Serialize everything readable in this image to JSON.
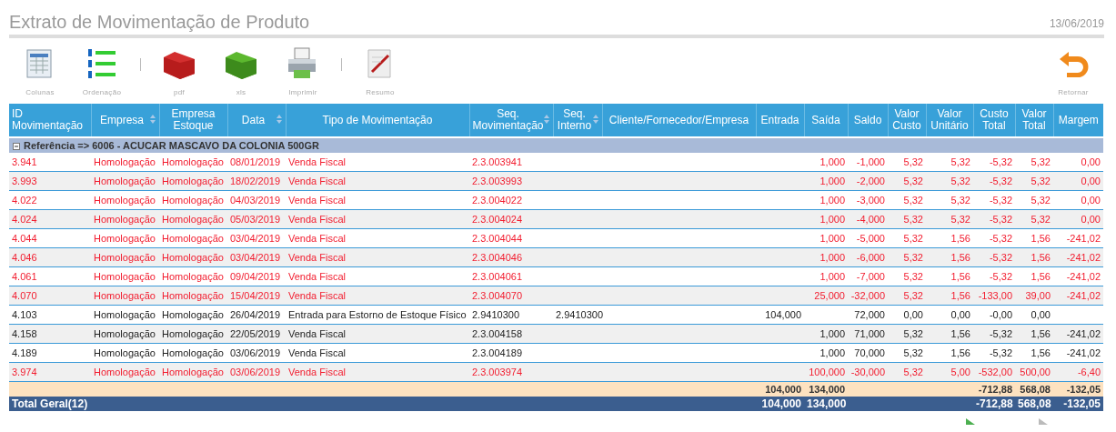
{
  "title": "Extrato de Movimentação de Produto",
  "date": "13/06/2019",
  "toolbar": [
    {
      "label": "Colunas",
      "kind": "columns"
    },
    {
      "label": "Ordenação",
      "kind": "order"
    },
    {
      "kind": "separator"
    },
    {
      "label": "pdf",
      "kind": "pdf"
    },
    {
      "label": "xls",
      "kind": "xls"
    },
    {
      "label": "Imprimir",
      "kind": "print"
    },
    {
      "kind": "separator"
    },
    {
      "label": "Resumo",
      "kind": "summary"
    }
  ],
  "return_button": {
    "label": "Retornar"
  },
  "table": {
    "columns": [
      {
        "label": "ID Movimentação",
        "sortable": false,
        "kind": "text"
      },
      {
        "label": "Empresa",
        "sortable": true,
        "kind": "text"
      },
      {
        "label": "Empresa Estoque",
        "sortable": false,
        "kind": "text"
      },
      {
        "label": "Data",
        "sortable": true,
        "kind": "text"
      },
      {
        "label": "Tipo de Movimentação",
        "sortable": false,
        "kind": "text"
      },
      {
        "label": "Seq. Movimentação",
        "sortable": true,
        "kind": "text"
      },
      {
        "label": "Seq. Interno",
        "sortable": true,
        "kind": "text"
      },
      {
        "label": "Cliente/Fornecedor/Empresa",
        "sortable": false,
        "kind": "text"
      },
      {
        "label": "Entrada",
        "sortable": false,
        "kind": "number"
      },
      {
        "label": "Saída",
        "sortable": false,
        "kind": "number"
      },
      {
        "label": "Saldo",
        "sortable": false,
        "kind": "number"
      },
      {
        "label": "Valor Custo",
        "sortable": false,
        "kind": "number"
      },
      {
        "label": "Valor Unitário",
        "sortable": false,
        "kind": "number"
      },
      {
        "label": "Custo Total",
        "sortable": false,
        "kind": "number"
      },
      {
        "label": "Valor Total",
        "sortable": false,
        "kind": "number"
      },
      {
        "label": "Margem",
        "sortable": false,
        "kind": "number"
      }
    ],
    "group": {
      "label": "Referência => 6006 - ACUCAR MASCAVO DA COLONIA 500GR",
      "expanded": true
    },
    "rows": [
      {
        "negative": true,
        "cells": [
          "3.941",
          "Homologação",
          "Homologação",
          "08/01/2019",
          "Venda Fiscal",
          "2.3.003941",
          null,
          null,
          null,
          "1,000",
          "-1,000",
          "5,32",
          "5,32",
          "-5,32",
          "5,32",
          "0,00"
        ]
      },
      {
        "negative": true,
        "cells": [
          "3.993",
          "Homologação",
          "Homologação",
          "18/02/2019",
          "Venda Fiscal",
          "2.3.003993",
          null,
          null,
          null,
          "1,000",
          "-2,000",
          "5,32",
          "5,32",
          "-5,32",
          "5,32",
          "0,00"
        ]
      },
      {
        "negative": true,
        "cells": [
          "4.022",
          "Homologação",
          "Homologação",
          "04/03/2019",
          "Venda Fiscal",
          "2.3.004022",
          null,
          null,
          null,
          "1,000",
          "-3,000",
          "5,32",
          "5,32",
          "-5,32",
          "5,32",
          "0,00"
        ]
      },
      {
        "negative": true,
        "cells": [
          "4.024",
          "Homologação",
          "Homologação",
          "05/03/2019",
          "Venda Fiscal",
          "2.3.004024",
          null,
          null,
          null,
          "1,000",
          "-4,000",
          "5,32",
          "5,32",
          "-5,32",
          "5,32",
          "0,00"
        ]
      },
      {
        "negative": true,
        "cells": [
          "4.044",
          "Homologação",
          "Homologação",
          "03/04/2019",
          "Venda Fiscal",
          "2.3.004044",
          null,
          null,
          null,
          "1,000",
          "-5,000",
          "5,32",
          "1,56",
          "-5,32",
          "1,56",
          "-241,02"
        ]
      },
      {
        "negative": true,
        "cells": [
          "4.046",
          "Homologação",
          "Homologação",
          "03/04/2019",
          "Venda Fiscal",
          "2.3.004046",
          null,
          null,
          null,
          "1,000",
          "-6,000",
          "5,32",
          "1,56",
          "-5,32",
          "1,56",
          "-241,02"
        ]
      },
      {
        "negative": true,
        "cells": [
          "4.061",
          "Homologação",
          "Homologação",
          "09/04/2019",
          "Venda Fiscal",
          "2.3.004061",
          null,
          null,
          null,
          "1,000",
          "-7,000",
          "5,32",
          "1,56",
          "-5,32",
          "1,56",
          "-241,02"
        ]
      },
      {
        "negative": true,
        "cells": [
          "4.070",
          "Homologação",
          "Homologação",
          "15/04/2019",
          "Venda Fiscal",
          "2.3.004070",
          null,
          null,
          null,
          "25,000",
          "-32,000",
          "5,32",
          "1,56",
          "-133,00",
          "39,00",
          "-241,02"
        ]
      },
      {
        "negative": false,
        "cells": [
          "4.103",
          "Homologação",
          "Homologação",
          "26/04/2019",
          "Entrada para Estorno de Estoque Físico",
          "2.9410300",
          "2.9410300",
          null,
          "104,000",
          null,
          "72,000",
          "0,00",
          "0,00",
          "-0,00",
          "0,00",
          null
        ]
      },
      {
        "negative": false,
        "cells": [
          "4.158",
          "Homologação",
          "Homologação",
          "22/05/2019",
          "Venda Fiscal",
          "2.3.004158",
          null,
          null,
          null,
          "1,000",
          "71,000",
          "5,32",
          "1,56",
          "-5,32",
          "1,56",
          "-241,02"
        ]
      },
      {
        "negative": false,
        "cells": [
          "4.189",
          "Homologação",
          "Homologação",
          "03/06/2019",
          "Venda Fiscal",
          "2.3.004189",
          null,
          null,
          null,
          "1,000",
          "70,000",
          "5,32",
          "1,56",
          "-5,32",
          "1,56",
          "-241,02"
        ]
      },
      {
        "negative": true,
        "cells": [
          "3.974",
          "Homologação",
          "Homologação",
          "03/06/2019",
          "Venda Fiscal",
          "2.3.003974",
          null,
          null,
          null,
          "100,000",
          "-30,000",
          "5,32",
          "5,00",
          "-532,00",
          "500,00",
          "-6,40"
        ]
      }
    ],
    "subtotal": {
      "entrada": "104,000",
      "saida": "134,000",
      "custo_total": "-712,88",
      "valor_total": "568,08",
      "margem": "-132,05"
    },
    "total": {
      "label": "Total Geral(12)",
      "entrada": "104,000",
      "saida": "134,000",
      "custo_total": "-712,88",
      "valor_total": "568,08",
      "margem": "-132,05"
    }
  }
}
